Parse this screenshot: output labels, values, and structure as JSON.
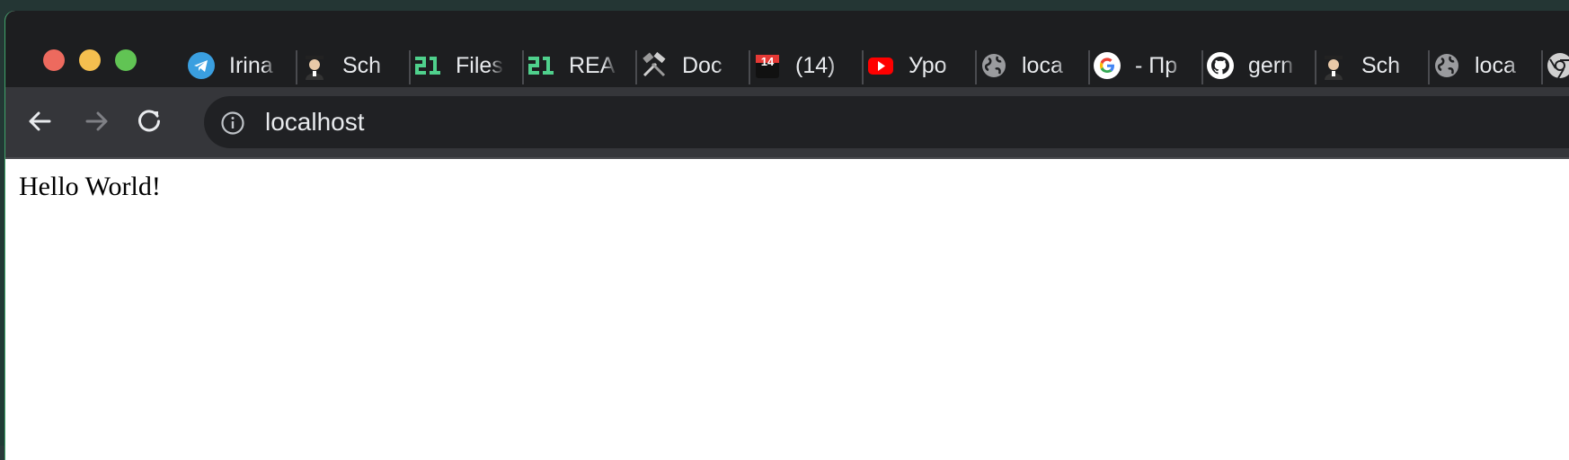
{
  "window": {
    "traffic_lights": [
      "close",
      "minimize",
      "maximize"
    ]
  },
  "tabs": [
    {
      "icon": "telegram-icon",
      "label": "Irina",
      "color": "#2aa3e0"
    },
    {
      "icon": "graduate-icon",
      "label": "Sch",
      "color": "#c9c9c9"
    },
    {
      "icon": "school21-icon",
      "label": "Files",
      "color": "#4fd08c"
    },
    {
      "icon": "school21-icon",
      "label": "REA",
      "color": "#4fd08c"
    },
    {
      "icon": "tools-icon",
      "label": "Doc",
      "color": "#d9d9d9"
    },
    {
      "icon": "calendar-badge-icon",
      "label": "(14)",
      "badge": "14",
      "color": "#e53935"
    },
    {
      "icon": "youtube-icon",
      "label": "Уро",
      "color": "#ff0000"
    },
    {
      "icon": "globe-icon",
      "label": "loca",
      "color": "#b0b0b0"
    },
    {
      "icon": "google-icon",
      "label": "- Пр",
      "color": "#ffffff"
    },
    {
      "icon": "github-icon",
      "label": "gern",
      "color": "#ffffff"
    },
    {
      "icon": "graduate-icon",
      "label": "Sch",
      "color": "#c9c9c9"
    },
    {
      "icon": "globe-icon",
      "label": "loca",
      "color": "#b0b0b0"
    },
    {
      "icon": "chrome-icon",
      "label": "",
      "color": "#d0d0d0"
    }
  ],
  "toolbar": {
    "back_icon": "arrow-left-icon",
    "forward_icon": "arrow-right-icon",
    "reload_icon": "reload-icon",
    "address": "localhost",
    "info_icon": "info-icon"
  },
  "page": {
    "body_text": "Hello World!"
  }
}
